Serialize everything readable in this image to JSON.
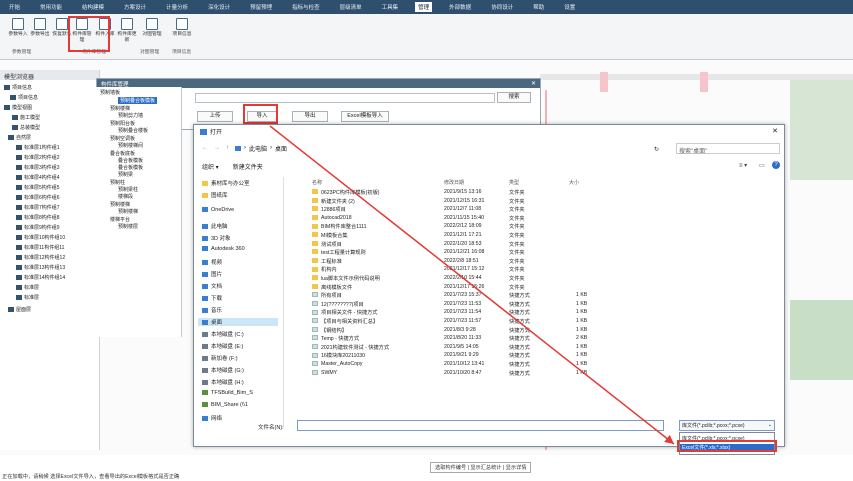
{
  "menubar": {
    "items": [
      "开始",
      "常用功能",
      "结构建模",
      "方案设计",
      "计量分析",
      "深化设计",
      "预留预埋",
      "指标与检查",
      "层级清单",
      "工具集",
      "管理",
      "外部数据",
      "协同设计",
      "帮助",
      "设置"
    ],
    "active_index": 10
  },
  "ribbon": {
    "buttons": [
      {
        "label": "参数导入",
        "icon": "import-icon"
      },
      {
        "label": "参数导出",
        "icon": "export-icon"
      },
      {
        "label": "恢复默认",
        "icon": "reset-icon"
      },
      {
        "label": "构件库管理",
        "icon": "library-icon"
      },
      {
        "label": "构件入库",
        "icon": "store-icon"
      },
      {
        "label": "构件库更新",
        "icon": "update-icon"
      },
      {
        "label": "对图管理",
        "icon": "drawing-icon"
      },
      {
        "label": "项目信息",
        "icon": "info-icon"
      }
    ],
    "groups": [
      "参数管理",
      "构件库管理",
      "对图管理",
      "项目信息"
    ]
  },
  "left_panel": {
    "title": "模型浏览器",
    "items": [
      "项目信息",
      "项目信息",
      "模型视图",
      "施工模型",
      "总装模型",
      "自然层",
      "标准层1构件组1",
      "标准层2构件组2",
      "标准层3构件组3",
      "标准层4构件组4",
      "标准层5构件组5",
      "标准层6构件组6",
      "标准层7构件组7",
      "标准层8构件组8",
      "标准层9构件组9",
      "标准层10构件组10",
      "标准层11构件组11",
      "标准层12构件组12",
      "标准层13构件组13",
      "标准层14构件组14",
      "标准层",
      "标准层",
      "屋面层"
    ]
  },
  "lib_manager": {
    "title": "构件库管理",
    "tree": [
      "预制墙板",
      "预制叠合板模板",
      "预制楼梯",
      "预制剪力墙",
      "预制阳台板",
      "预制叠合楼板",
      "预制空调板",
      "预制楼梯间",
      "叠合板底板",
      "叠合板模板",
      "叠合板模板",
      "预制梁",
      "预制柱",
      "预制梁柱",
      "楼梯段",
      "预制楼梯",
      "预制楼梯",
      "楼梯平台",
      "预制楼层"
    ],
    "buttons": [
      "上传",
      "导入",
      "导出",
      "Excel模板导入"
    ],
    "search_btn": "搜索"
  },
  "open_dialog": {
    "title": "打开",
    "path": [
      "此电脑",
      "桌面"
    ],
    "refresh": "↻",
    "search_placeholder": "搜索\"桌面\"",
    "organize": "组织 ▾",
    "new_folder": "新建文件夹",
    "columns": [
      "名称",
      "修改日期",
      "类型",
      "大小"
    ],
    "sidebar": [
      {
        "label": "素材库与办公室",
        "icon": "folder-icon"
      },
      {
        "label": "图纸库",
        "icon": "folder-icon"
      },
      {
        "label": "OneDrive",
        "icon": "cloud-icon"
      },
      {
        "label": "此电脑",
        "icon": "pc-icon"
      },
      {
        "label": "3D 对象",
        "icon": "cube-icon"
      },
      {
        "label": "Autodesk 360",
        "icon": "autodesk-icon"
      },
      {
        "label": "视频",
        "icon": "video-icon"
      },
      {
        "label": "图片",
        "icon": "picture-icon"
      },
      {
        "label": "文档",
        "icon": "document-icon"
      },
      {
        "label": "下载",
        "icon": "download-icon"
      },
      {
        "label": "音乐",
        "icon": "music-icon"
      },
      {
        "label": "桌面",
        "icon": "desktop-icon"
      },
      {
        "label": "本地磁盘 (C:)",
        "icon": "drive-icon"
      },
      {
        "label": "本地磁盘 (E:)",
        "icon": "drive-icon"
      },
      {
        "label": "新加卷 (F:)",
        "icon": "drive-icon"
      },
      {
        "label": "本地磁盘 (G:)",
        "icon": "drive-icon"
      },
      {
        "label": "本地磁盘 (H:)",
        "icon": "drive-icon"
      },
      {
        "label": "TFSBuild_Bim_S",
        "icon": "netdrive-icon"
      },
      {
        "label": "BIM_Share (\\\\1",
        "icon": "netdrive-icon"
      },
      {
        "label": "网络",
        "icon": "network-icon"
      }
    ],
    "files": [
      {
        "name": "0623PC构件库模板(初版)",
        "date": "2021/9/15 13:16",
        "type": "文件夹",
        "size": "",
        "kind": "folder"
      },
      {
        "name": "新建文件夹 (2)",
        "date": "2021/12/15 16:31",
        "type": "文件夹",
        "size": "",
        "kind": "folder"
      },
      {
        "name": "12886项目",
        "date": "2021/12/7 11:08",
        "type": "文件夹",
        "size": "",
        "kind": "folder"
      },
      {
        "name": "Autocad2018",
        "date": "2021/11/15 15:40",
        "type": "文件夹",
        "size": "",
        "kind": "folder"
      },
      {
        "name": "BIM构件库整合1111",
        "date": "2022/2/12 18:09",
        "type": "文件夹",
        "size": "",
        "kind": "folder"
      },
      {
        "name": "MI模板合集",
        "date": "2021/12/1 17:21",
        "type": "文件夹",
        "size": "",
        "kind": "folder"
      },
      {
        "name": "测试项目",
        "date": "2022/1/20 18:53",
        "type": "文件夹",
        "size": "",
        "kind": "folder"
      },
      {
        "name": "test工程量计算规则",
        "date": "2021/12/21 16:08",
        "type": "文件夹",
        "size": "",
        "kind": "folder"
      },
      {
        "name": "工程标准",
        "date": "2022/2/8 18:51",
        "type": "文件夹",
        "size": "",
        "kind": "folder"
      },
      {
        "name": "机构内",
        "date": "2021/12/17 15:12",
        "type": "文件夹",
        "size": "",
        "kind": "folder"
      },
      {
        "name": "lua脚本文件示例代码说明",
        "date": "2022/2/10 15:44",
        "type": "文件夹",
        "size": "",
        "kind": "folder"
      },
      {
        "name": "离线模板文件",
        "date": "2021/12/17 15:26",
        "type": "文件夹",
        "size": "",
        "kind": "folder"
      },
      {
        "name": "所有项目",
        "date": "2021/7/23 15:37",
        "type": "快捷方式",
        "size": "1 KB",
        "kind": "link"
      },
      {
        "name": "12(????????)项目",
        "date": "2021/7/23 11:53",
        "type": "快捷方式",
        "size": "1 KB",
        "kind": "link"
      },
      {
        "name": "项目相关文件 - 快捷方式",
        "date": "2021/7/23 11:54",
        "type": "快捷方式",
        "size": "1 KB",
        "kind": "link"
      },
      {
        "name": "【项目与相关资料汇总】",
        "date": "2021/7/23 11:57",
        "type": "快捷方式",
        "size": "1 KB",
        "kind": "link"
      },
      {
        "name": "【钢结构】",
        "date": "2021/8/3 9:28",
        "type": "快捷方式",
        "size": "1 KB",
        "kind": "link"
      },
      {
        "name": "Temp - 快捷方式",
        "date": "2021/8/20 11:33",
        "type": "快捷方式",
        "size": "2 KB",
        "kind": "link"
      },
      {
        "name": "2021构建软件测试 - 快捷方式",
        "date": "2021/9/5 14:05",
        "type": "快捷方式",
        "size": "1 KB",
        "kind": "link"
      },
      {
        "name": "16模块库20211030",
        "date": "2021/9/21 9:29",
        "type": "快捷方式",
        "size": "1 KB",
        "kind": "link"
      },
      {
        "name": "Master_AutoCopy",
        "date": "2021/10/12 13:41",
        "type": "快捷方式",
        "size": "1 KB",
        "kind": "link"
      },
      {
        "name": "SWMY",
        "date": "2021/10/20 8:47",
        "type": "快捷方式",
        "size": "1 KB",
        "kind": "link"
      }
    ],
    "filename_label": "文件名(N):",
    "filename_value": "",
    "filetype_selected": "库文件(*.pclib;*.pcox;*.pcxe)",
    "filetype_options": [
      "库文件(*.pclib;*.pcox;*.pcxe)",
      "Excel文件(*.xls;*.xlsx)"
    ]
  },
  "status": {
    "text": "正在加载中，请稍候 选择Excel文件导入，查看导出的Excel模板格式是否正确",
    "nav": "选取构件编号 | 显示汇总统计 | 显示详情"
  }
}
